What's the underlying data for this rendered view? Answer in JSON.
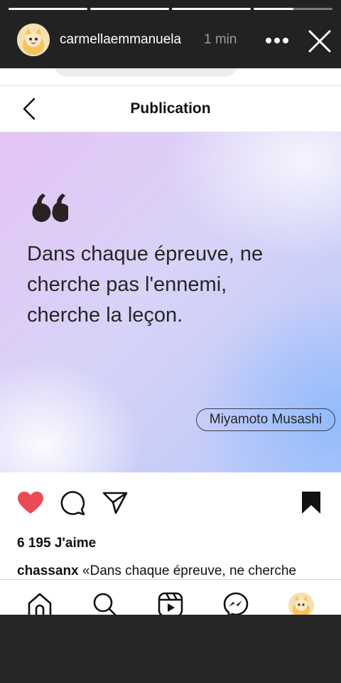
{
  "story": {
    "username": "carmellaemmanuela",
    "time": "1 min",
    "progress": [
      1,
      1,
      1,
      0.5
    ]
  },
  "post": {
    "header_title": "Publication",
    "quote_lines": [
      "Dans chaque épreuve, ne",
      "cherche pas l'ennemi,",
      "cherche la leçon."
    ],
    "author": "Miyamoto Musashi",
    "likes": "6 195 J'aime",
    "caption_user": "chassanx",
    "caption_text": "«Dans chaque épreuve, ne cherche"
  },
  "colors": {
    "like_red": "#ed4956",
    "text_dark": "#262626"
  },
  "icons": {
    "story": [
      "avatar",
      "more-icon",
      "close-icon"
    ],
    "actions": [
      "heart-icon",
      "comment-icon",
      "share-icon",
      "bookmark-icon"
    ],
    "nav": [
      "home-icon",
      "search-icon",
      "reels-icon",
      "messenger-icon",
      "profile-avatar"
    ]
  }
}
